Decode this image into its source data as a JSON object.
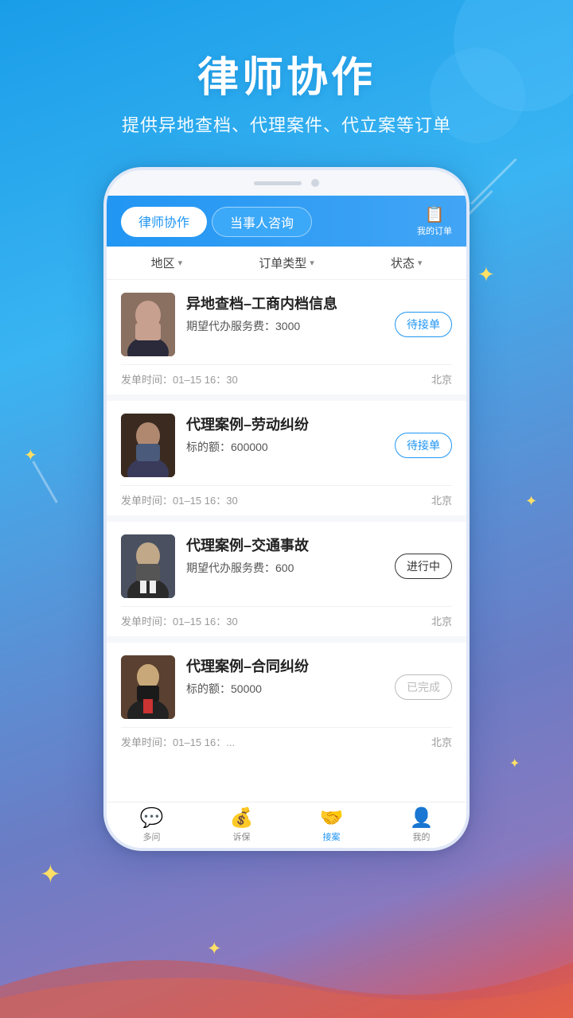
{
  "header": {
    "title": "律师协作",
    "subtitle": "提供异地查档、代理案件、代立案等订单"
  },
  "phone": {
    "tabs": [
      {
        "label": "律师协作",
        "active": true
      },
      {
        "label": "当事人咨询",
        "active": false
      }
    ],
    "my_orders_label": "我的订单",
    "filters": [
      {
        "label": "地区",
        "key": "region"
      },
      {
        "label": "订单类型",
        "key": "order_type"
      },
      {
        "label": "状态",
        "key": "status"
      }
    ],
    "orders": [
      {
        "id": 1,
        "title": "异地查档–工商内档信息",
        "detail_label": "期望代办服务费：",
        "detail_value": "3000",
        "time": "发单时间：01–15 16：30",
        "location": "北京",
        "status": "待接单",
        "status_type": "waiting",
        "avatar_type": "f1"
      },
      {
        "id": 2,
        "title": "代理案例–劳动纠纷",
        "detail_label": "标的额：",
        "detail_value": "600000",
        "time": "发单时间：01–15 16：30",
        "location": "北京",
        "status": "待接单",
        "status_type": "waiting",
        "avatar_type": "f2"
      },
      {
        "id": 3,
        "title": "代理案例–交通事故",
        "detail_label": "期望代办服务费：",
        "detail_value": "600",
        "time": "发单时间：01–15 16：30",
        "location": "北京",
        "status": "进行中",
        "status_type": "inprogress",
        "avatar_type": "m1"
      },
      {
        "id": 4,
        "title": "代理案例–合同纠纷",
        "detail_label": "标的额：",
        "detail_value": "50000",
        "time": "发单时间：01–15 16：...",
        "location": "北京",
        "status": "已完成",
        "status_type": "done",
        "avatar_type": "m2"
      }
    ],
    "bottom_nav": [
      {
        "label": "多问",
        "icon": "💬",
        "active": false,
        "key": "ask"
      },
      {
        "label": "诉保",
        "icon": "💰",
        "active": false,
        "key": "insurance"
      },
      {
        "label": "接案",
        "icon": "🤝",
        "active": true,
        "key": "cases"
      },
      {
        "label": "我的",
        "icon": "👤",
        "active": false,
        "key": "mine"
      }
    ]
  }
}
